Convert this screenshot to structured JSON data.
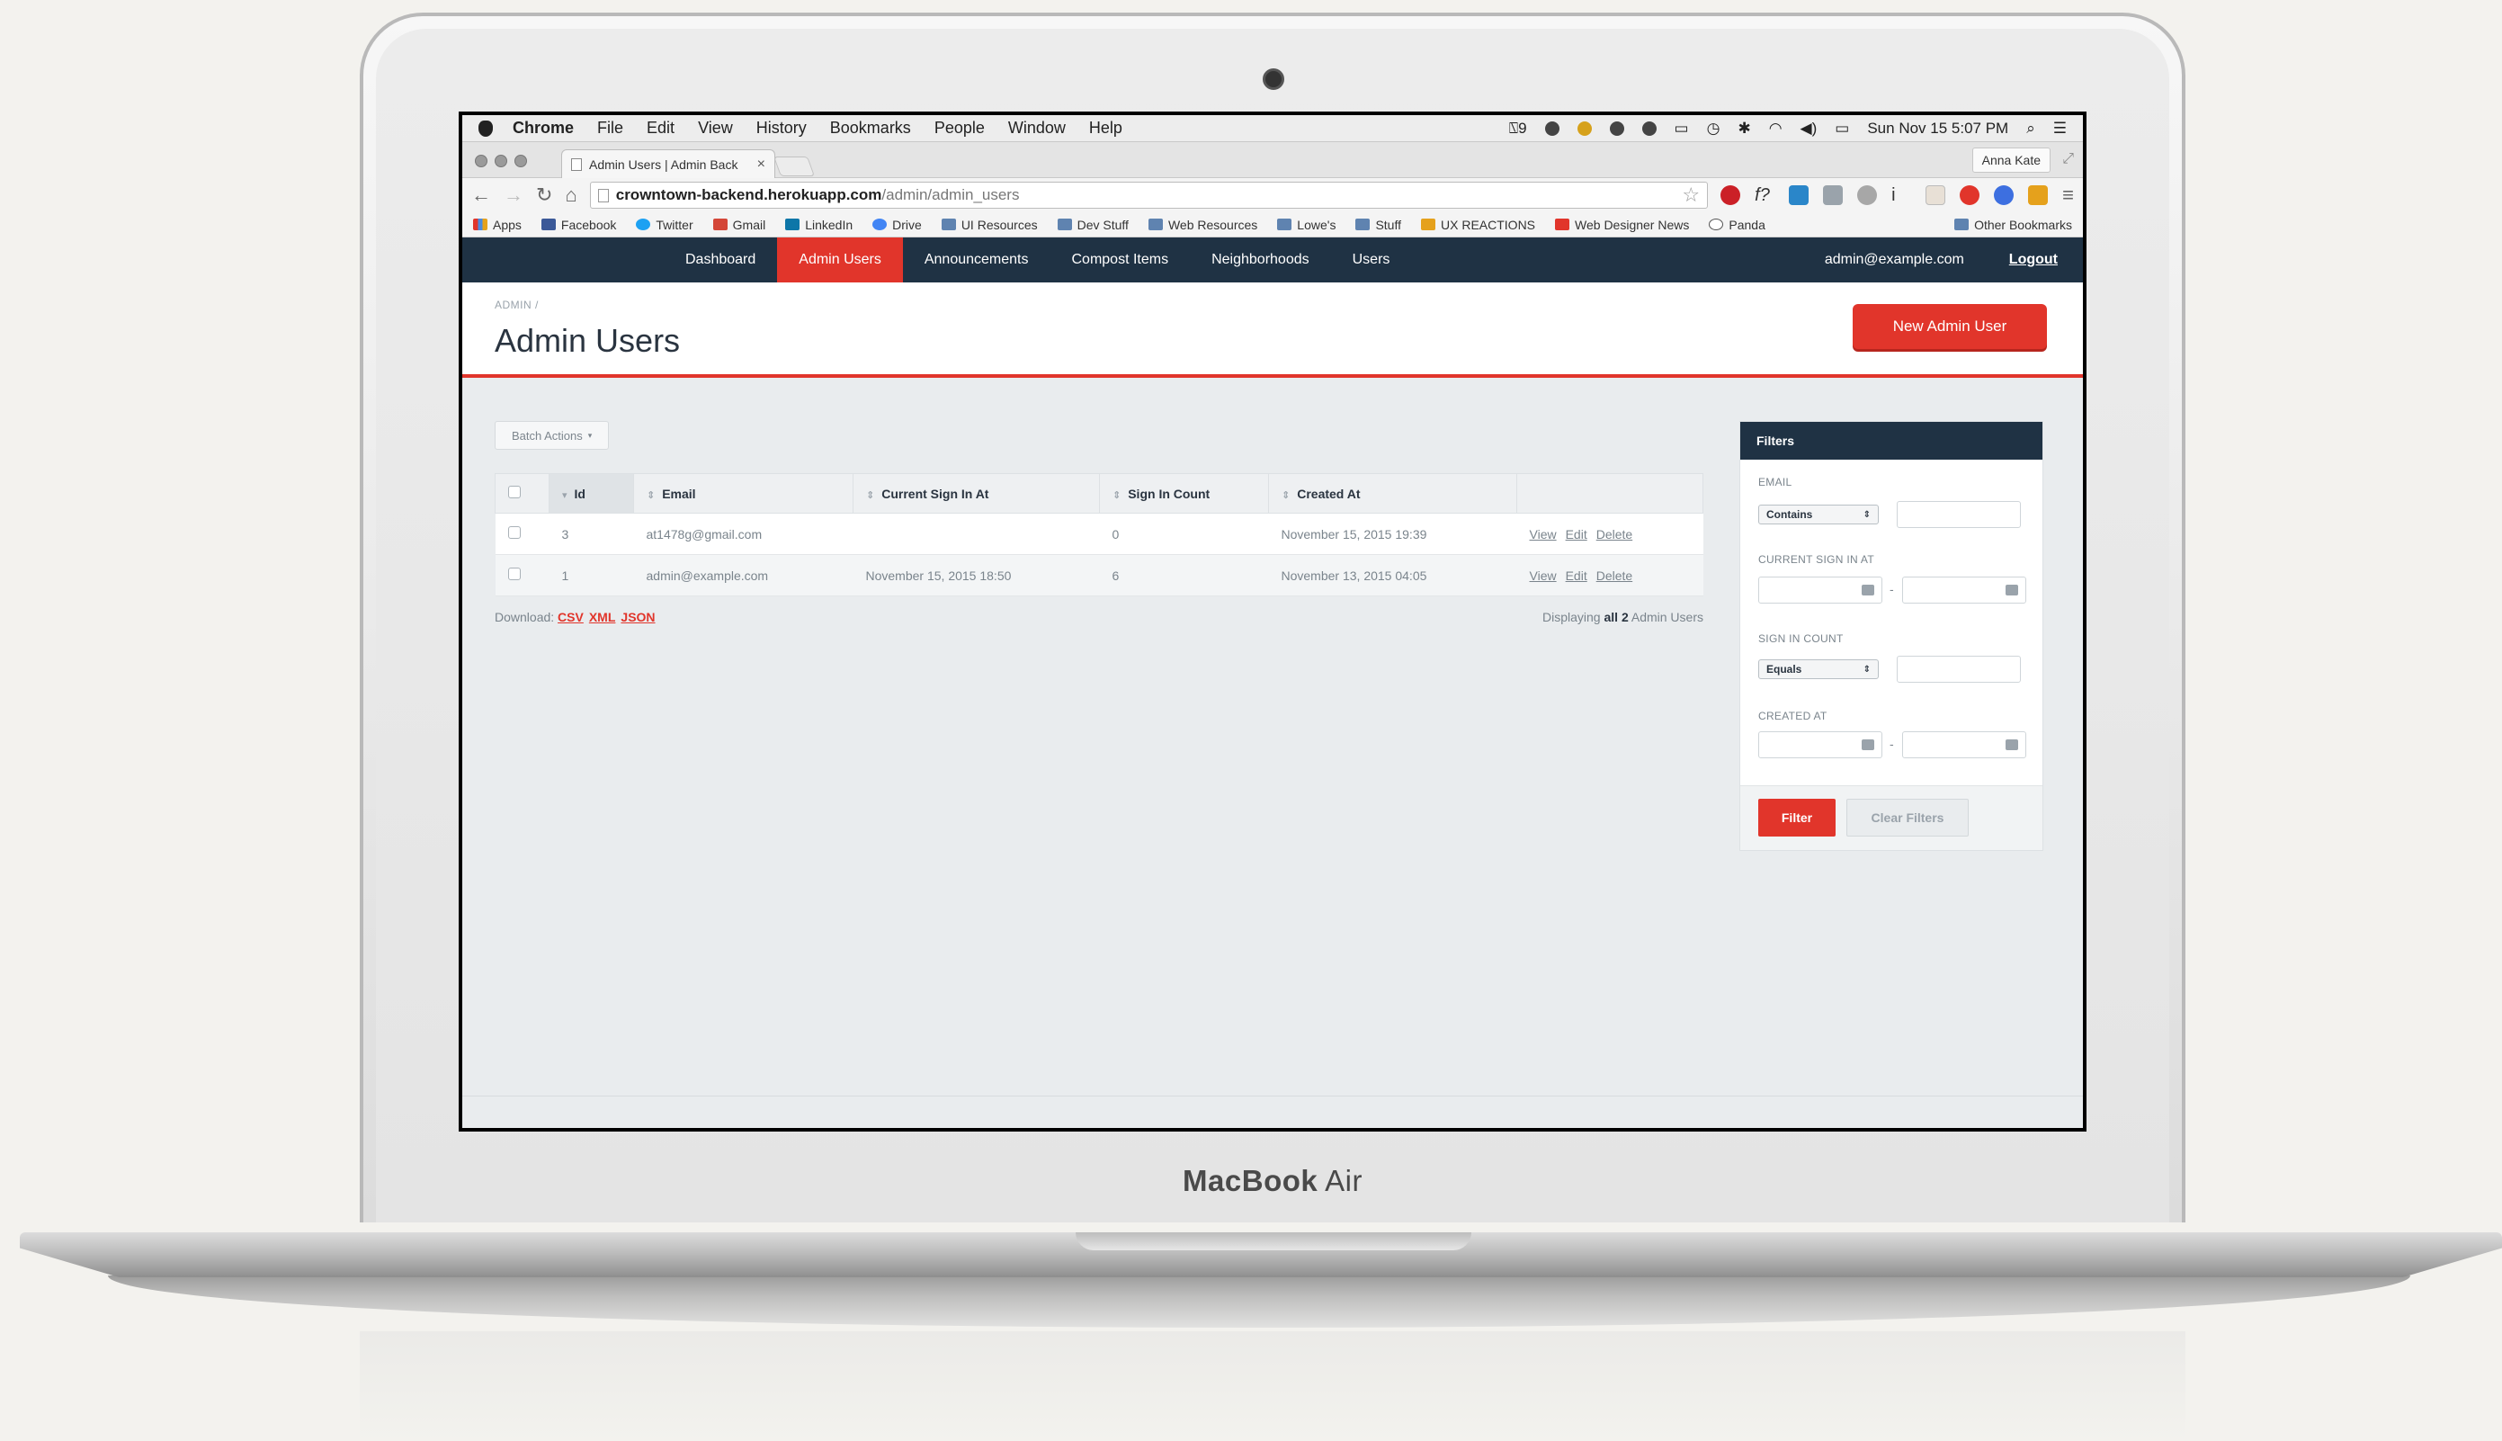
{
  "device": {
    "brand": "MacBook",
    "model": "Air"
  },
  "menubar": {
    "app": "Chrome",
    "items": [
      "File",
      "Edit",
      "View",
      "History",
      "Bookmarks",
      "People",
      "Window",
      "Help"
    ],
    "clock": "Sun Nov 15  5:07 PM",
    "battery_count": "9"
  },
  "browser": {
    "tab_title": "Admin Users | Admin Back",
    "profile": "Anna Kate",
    "url_host": "crowntown-backend.herokuapp.com",
    "url_path": "/admin/admin_users"
  },
  "bookmarks": [
    "Apps",
    "Facebook",
    "Twitter",
    "Gmail",
    "LinkedIn",
    "Drive",
    "UI Resources",
    "Dev Stuff",
    "Web Resources",
    "Lowe's",
    "Stuff",
    "UX REACTIONS",
    "Web Designer News",
    "Panda"
  ],
  "bookmarks_other": "Other Bookmarks",
  "nav": {
    "items": [
      "Dashboard",
      "Admin Users",
      "Announcements",
      "Compost Items",
      "Neighborhoods",
      "Users"
    ],
    "active_index": 1,
    "current_user": "admin@example.com",
    "logout": "Logout"
  },
  "header": {
    "breadcrumb": "ADMIN /",
    "title": "Admin Users",
    "new_button": "New Admin User"
  },
  "batch_actions": "Batch Actions",
  "table": {
    "columns": [
      "Id",
      "Email",
      "Current Sign In At",
      "Sign In Count",
      "Created At"
    ],
    "rows": [
      {
        "id": "3",
        "email": "at1478g@gmail.com",
        "current_sign_in_at": "",
        "sign_in_count": "0",
        "created_at": "November 15, 2015 19:39"
      },
      {
        "id": "1",
        "email": "admin@example.com",
        "current_sign_in_at": "November 15, 2015 18:50",
        "sign_in_count": "6",
        "created_at": "November 13, 2015 04:05"
      }
    ],
    "row_actions": [
      "View",
      "Edit",
      "Delete"
    ]
  },
  "download": {
    "label": "Download:",
    "formats": [
      "CSV",
      "XML",
      "JSON"
    ]
  },
  "displaying": {
    "prefix": "Displaying",
    "strong": "all 2",
    "suffix": "Admin Users"
  },
  "filters": {
    "title": "Filters",
    "email_label": "EMAIL",
    "email_operator": "Contains",
    "current_sign_in_label": "CURRENT SIGN IN AT",
    "sign_in_count_label": "SIGN IN COUNT",
    "sign_in_count_operator": "Equals",
    "created_at_label": "CREATED AT",
    "range_separator": "-",
    "filter_button": "Filter",
    "clear_button": "Clear Filters"
  },
  "colors": {
    "accent": "#e1352b",
    "nav_bg": "#1f3244"
  }
}
